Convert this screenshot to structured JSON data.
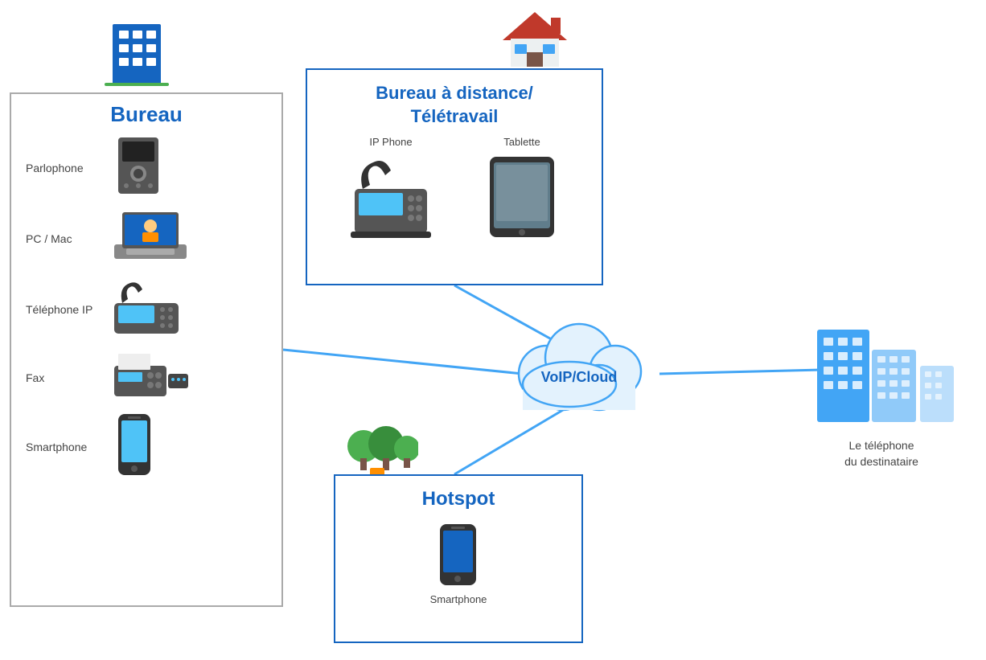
{
  "bureau": {
    "title": "Bureau",
    "items": [
      {
        "label": "Parlophone",
        "icon": "parlophone"
      },
      {
        "label": "PC / Mac",
        "icon": "pc-mac"
      },
      {
        "label": "Téléphone IP",
        "icon": "telephone-ip"
      },
      {
        "label": "Fax",
        "icon": "fax"
      },
      {
        "label": "Smartphone",
        "icon": "smartphone"
      }
    ]
  },
  "remote": {
    "title": "Bureau à distance/\nTélétravail",
    "items": [
      {
        "label": "IP Phone",
        "icon": "ip-phone"
      },
      {
        "label": "Tablette",
        "icon": "tablette"
      }
    ]
  },
  "hotspot": {
    "title": "Hotspot",
    "items": [
      {
        "label": "Smartphone",
        "icon": "smartphone"
      }
    ]
  },
  "voip": {
    "label": "VoIP/Cloud"
  },
  "recipient": {
    "label": "Le téléphone\ndu destinataire"
  },
  "colors": {
    "blue": "#1565c0",
    "line": "#42a5f5"
  }
}
